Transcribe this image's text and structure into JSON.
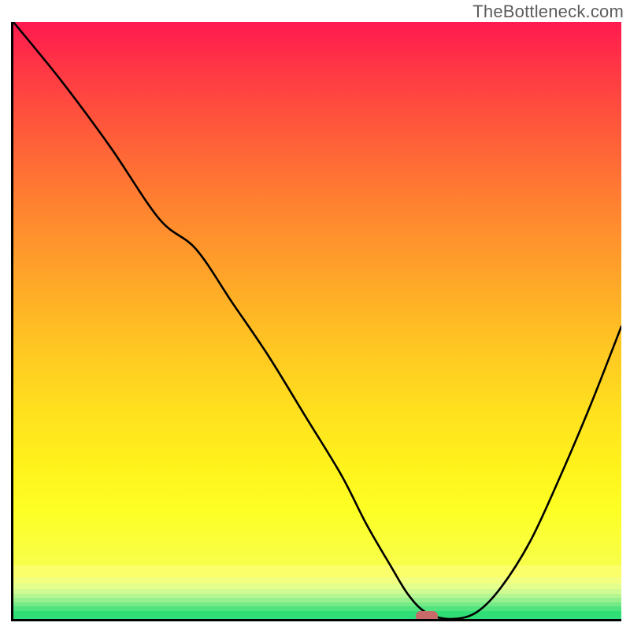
{
  "watermark": "TheBottleneck.com",
  "colors": {
    "gradient_top": "#ff1a50",
    "gradient_mid_orange": "#ffa828",
    "gradient_yellow": "#fff31c",
    "gradient_pale_yellow": "#fdff7a",
    "gradient_green": "#2fe37a",
    "marker": "#c96a6a",
    "axis": "#000000"
  },
  "bottom_bands": [
    {
      "top_pct": 0,
      "h_pct": 22,
      "color": "#fbff6a"
    },
    {
      "top_pct": 22,
      "h_pct": 12,
      "color": "#f2ff80"
    },
    {
      "top_pct": 34,
      "h_pct": 10,
      "color": "#e4ff8c"
    },
    {
      "top_pct": 44,
      "h_pct": 9,
      "color": "#d0fb92"
    },
    {
      "top_pct": 53,
      "h_pct": 8,
      "color": "#b6f692"
    },
    {
      "top_pct": 61,
      "h_pct": 8,
      "color": "#97f08d"
    },
    {
      "top_pct": 69,
      "h_pct": 8,
      "color": "#74ea86"
    },
    {
      "top_pct": 77,
      "h_pct": 8,
      "color": "#50e37e"
    },
    {
      "top_pct": 85,
      "h_pct": 15,
      "color": "#2fde76"
    }
  ],
  "chart_data": {
    "type": "line",
    "title": "",
    "xlabel": "",
    "ylabel": "",
    "xlim": [
      0,
      100
    ],
    "ylim": [
      0,
      100
    ],
    "series": [
      {
        "name": "bottleneck-curve",
        "x": [
          0,
          8,
          16,
          24,
          30,
          36,
          42,
          48,
          54,
          58,
          62,
          65,
          68,
          72,
          76,
          80,
          85,
          90,
          95,
          100
        ],
        "y": [
          100,
          90,
          79,
          67,
          62,
          53,
          44,
          34,
          24,
          16,
          9,
          4,
          1,
          0,
          1,
          5,
          13,
          24,
          36,
          49
        ]
      }
    ],
    "marker": {
      "x": 68,
      "y": 0,
      "shape": "rounded-bar"
    },
    "annotations": []
  }
}
